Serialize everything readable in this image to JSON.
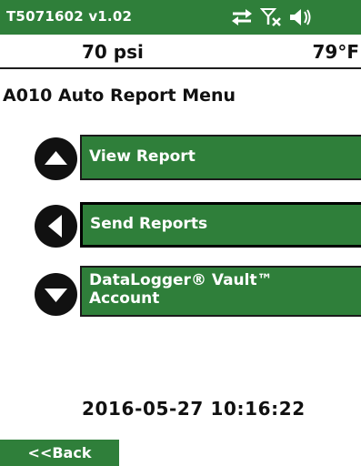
{
  "status_bar": {
    "device_id": "T5071602 v1.02",
    "icons": [
      "sync-arrows-icon",
      "no-signal-icon",
      "speaker-icon"
    ]
  },
  "readings": {
    "pressure": "70 psi",
    "temperature": "79°F"
  },
  "menu": {
    "title": "A010 Auto Report Menu",
    "items": [
      {
        "label": "View Report",
        "nav_icon": "up-arrow-icon"
      },
      {
        "label": "Send Reports",
        "nav_icon": "left-arrow-icon"
      },
      {
        "label": "DataLogger® Vault™\nAccount",
        "nav_icon": "down-arrow-icon"
      }
    ]
  },
  "datetime": "2016-05-27  10:16:22",
  "back_label": "<<Back",
  "colors": {
    "accent_green": "#2f7f3a",
    "text_dark": "#111111",
    "background": "#ffffff"
  }
}
